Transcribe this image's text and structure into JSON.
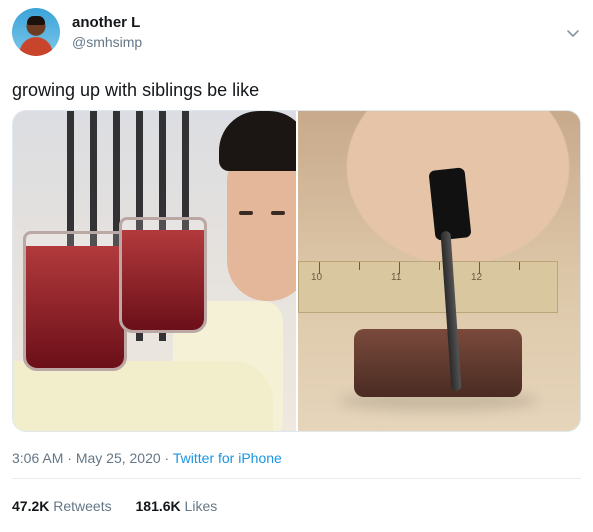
{
  "author": {
    "name": "another L",
    "handle": "@smhsimp"
  },
  "tweet_text": "growing up with siblings be like",
  "ruler_numbers": [
    "10",
    "11",
    "12"
  ],
  "meta": {
    "time": "3:06 AM",
    "sep1": " · ",
    "date": "May 25, 2020",
    "sep2": " · ",
    "source": "Twitter for iPhone"
  },
  "stats": {
    "retweets_count": "47.2K",
    "retweets_label": "Retweets",
    "likes_count": "181.6K",
    "likes_label": "Likes"
  },
  "icons": {
    "menu": "chevron-down-icon"
  },
  "colors": {
    "text_primary": "#14171a",
    "text_secondary": "#657786",
    "link": "#1b95e0"
  }
}
